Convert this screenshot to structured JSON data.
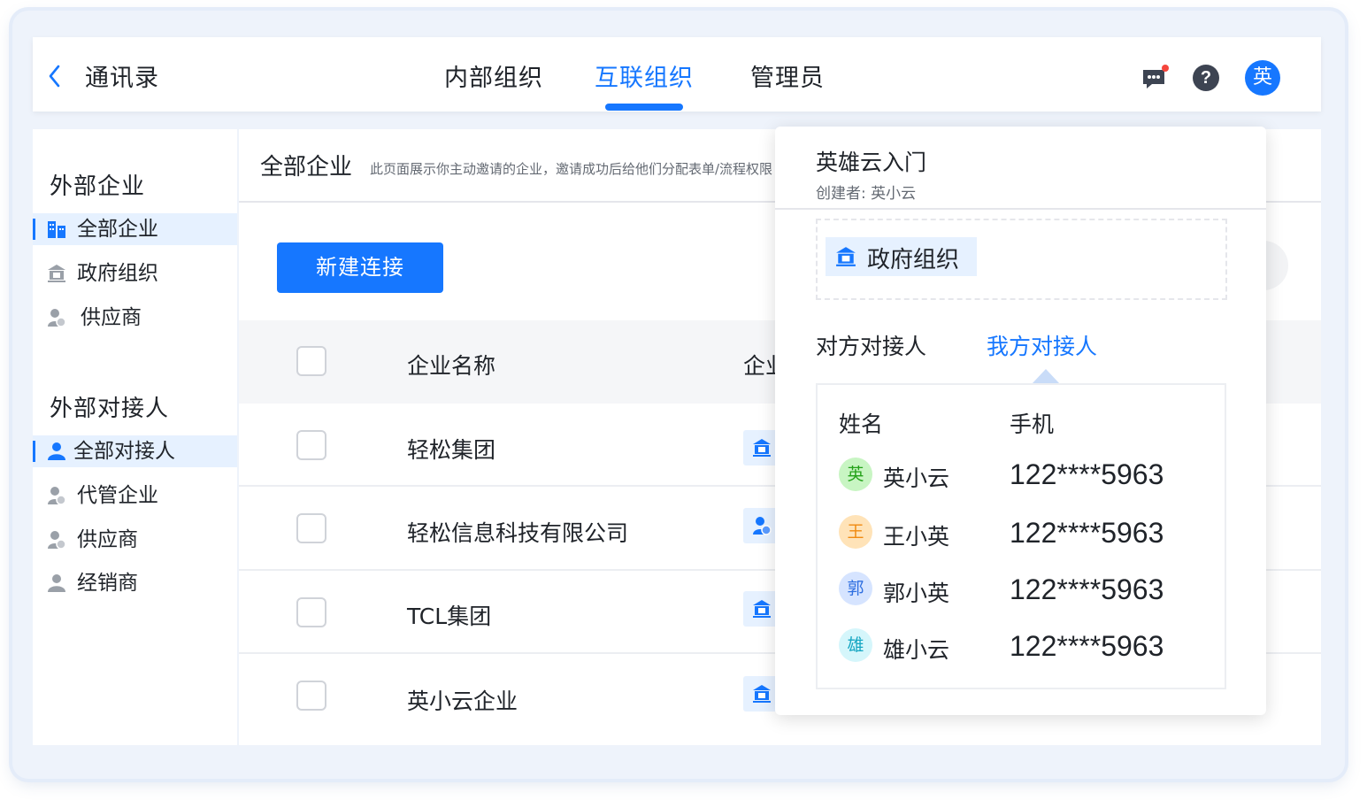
{
  "header": {
    "back_label": "通讯录",
    "tabs": [
      {
        "label": "内部组织",
        "active": false
      },
      {
        "label": "互联组织",
        "active": true
      },
      {
        "label": "管理员",
        "active": false
      }
    ],
    "help_label": "?",
    "avatar_text": "英"
  },
  "sidebar": {
    "section1_title": "外部企业",
    "section1_items": [
      {
        "label": "全部企业",
        "icon": "building-icon",
        "active": true
      },
      {
        "label": "政府组织",
        "icon": "government-icon",
        "active": false
      },
      {
        "label": "供应商",
        "icon": "supplier-icon",
        "active": false
      }
    ],
    "section2_title": "外部对接人",
    "section2_items": [
      {
        "label": "全部对接人",
        "icon": "person-icon",
        "active": true
      },
      {
        "label": "代管企业",
        "icon": "managed-person-icon",
        "active": false
      },
      {
        "label": "供应商",
        "icon": "supplier-icon",
        "active": false
      },
      {
        "label": "经销商",
        "icon": "dealer-icon",
        "active": false
      }
    ]
  },
  "main": {
    "title": "全部企业",
    "hint": "此页面展示你主动邀请的企业，邀请成功后给他们分配表单/流程权限",
    "new_button": "新建连接",
    "columns": [
      "企业名称",
      "企业类型"
    ],
    "rows": [
      {
        "name": "轻松集团",
        "type_icon": "government-icon"
      },
      {
        "name": "轻松信息科技有限公司",
        "type_icon": "supplier-icon"
      },
      {
        "name": "TCL集团",
        "type_icon": "government-icon"
      },
      {
        "name": "英小云企业",
        "type_icon": "government-icon"
      }
    ]
  },
  "popup": {
    "title": "英雄云入门",
    "creator": "创建者: 英小云",
    "org_chip": "政府组织",
    "tabs": [
      {
        "label": "对方对接人",
        "active": false
      },
      {
        "label": "我方对接人",
        "active": true
      }
    ],
    "contact_headers": [
      "姓名",
      "手机"
    ],
    "contacts": [
      {
        "initial": "英",
        "name": "英小云",
        "phone": "122****5963",
        "bg": "#c8f5c3",
        "fg": "#25a21a"
      },
      {
        "initial": "王",
        "name": "王小英",
        "phone": "122****5963",
        "bg": "#ffe3b8",
        "fg": "#f08a10"
      },
      {
        "initial": "郭",
        "name": "郭小英",
        "phone": "122****5963",
        "bg": "#d6e4ff",
        "fg": "#2f6fe0"
      },
      {
        "initial": "雄",
        "name": "雄小云",
        "phone": "122****5963",
        "bg": "#d5f6fb",
        "fg": "#15a6c2"
      }
    ]
  },
  "colors": {
    "accent": "#1677ff",
    "sidebar_active_bg": "#e6f1ff"
  }
}
